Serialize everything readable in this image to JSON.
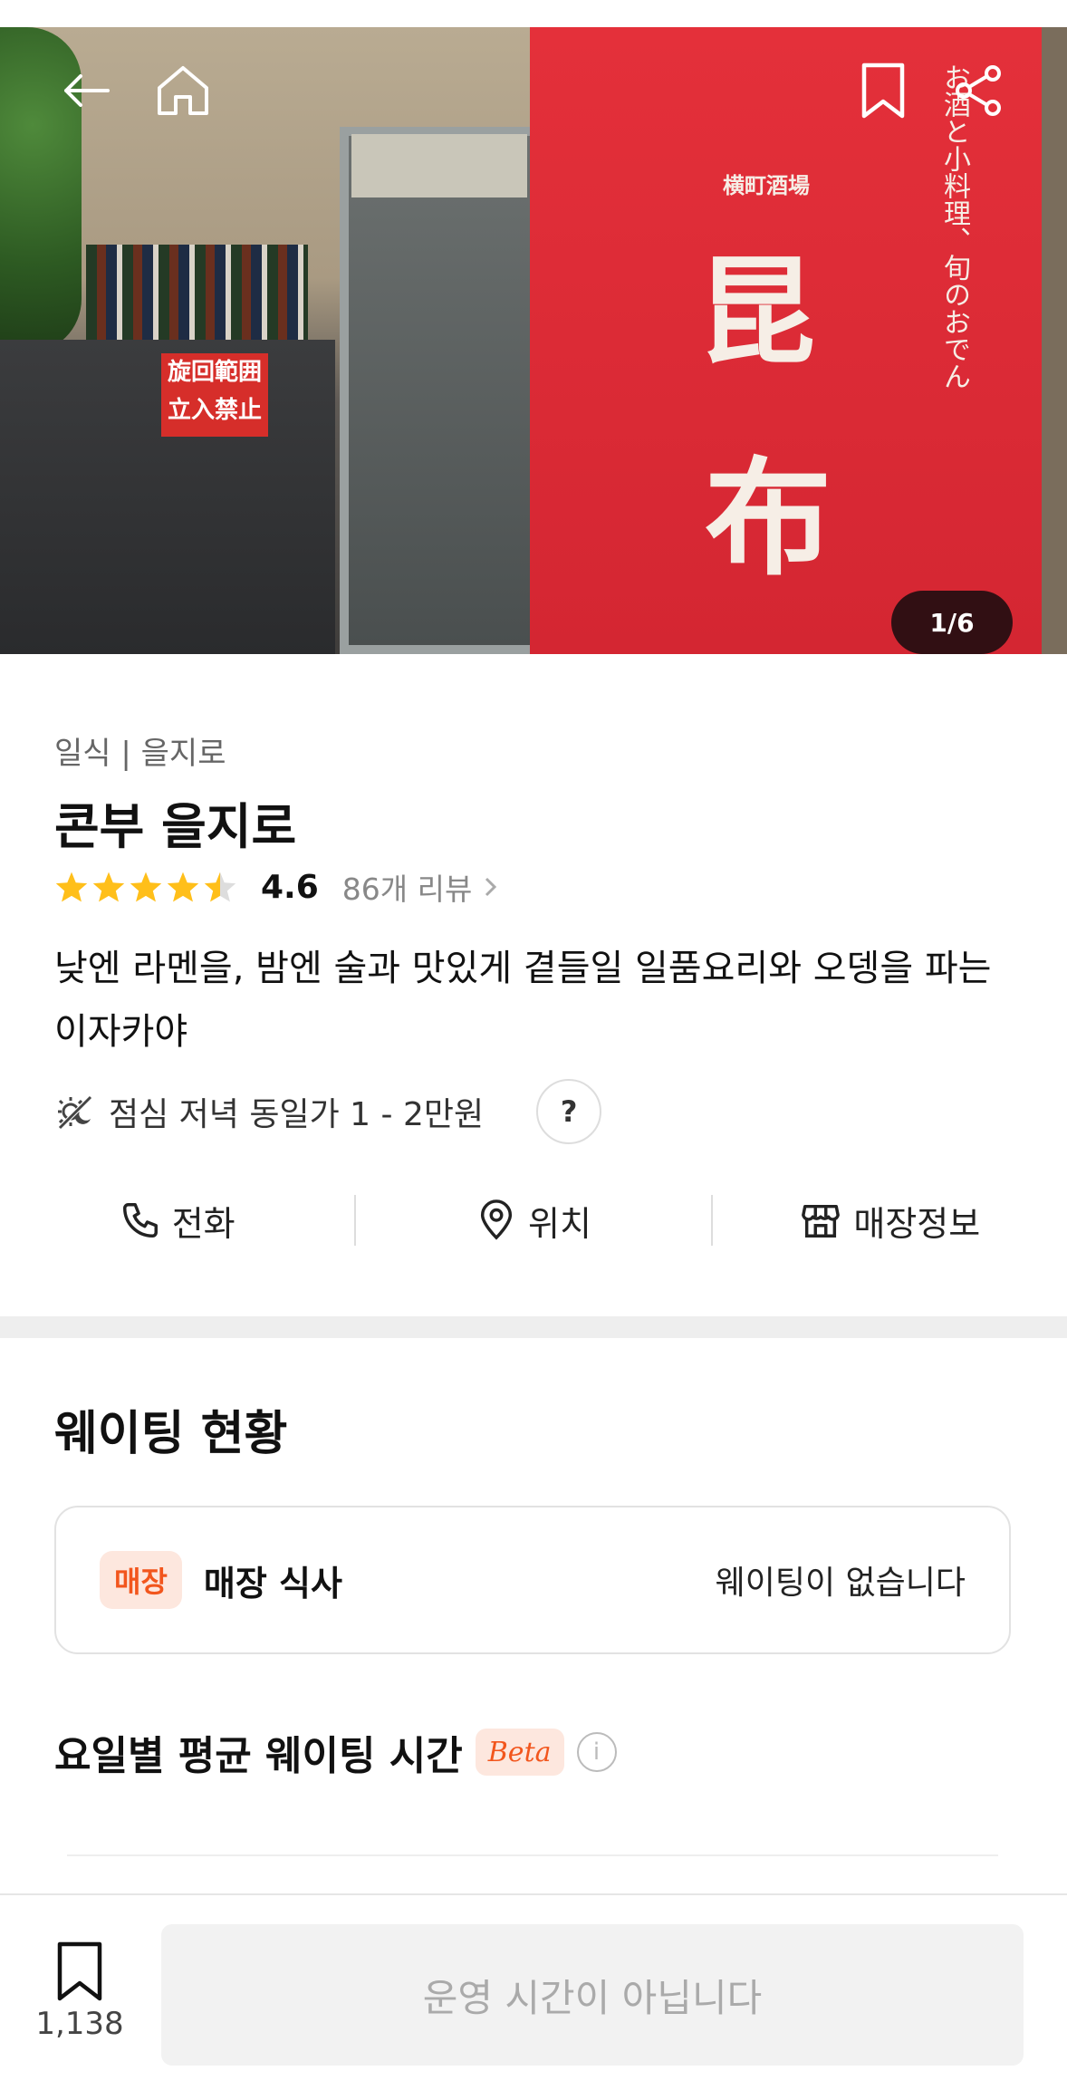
{
  "hero": {
    "counter": "1/6",
    "curtain_small_text": "横町酒場",
    "curtain_kanji_top": "昆",
    "curtain_kanji_bottom": "布",
    "curtain_vertical_text": "お酒と小料理、旬のおでん",
    "sign_text": "旋回範囲 立入禁止"
  },
  "topbar": {
    "icons": [
      "back-arrow-icon",
      "home-icon",
      "bookmark-icon",
      "share-icon"
    ]
  },
  "restaurant": {
    "category": "일식 | 을지로",
    "name": "콘부 을지로",
    "rating": "4.6",
    "stars_filled": 4.5,
    "review_link": "86개 리뷰",
    "description": "낮엔 라멘을, 밤엔 술과 맛있게 곁들일 일품요리와 오뎅을 파는 이자카야",
    "price": "점심 저녁 동일가 1 - 2만원",
    "help_label": "?"
  },
  "actions": {
    "call": "전화",
    "location": "위치",
    "store_info": "매장정보"
  },
  "waiting": {
    "title": "웨이팅 현황",
    "badge": "매장",
    "dine_in_label": "매장 식사",
    "status": "웨이팅이 없습니다",
    "avg_title": "요일별 평균 웨이팅 시간",
    "beta_label": "Beta",
    "info_label": "i"
  },
  "bottom": {
    "bookmark_count": "1,138",
    "cta_label": "운영 시간이 아닙니다"
  },
  "colors": {
    "accent": "#f2561d",
    "badge_bg": "#fde7de",
    "star": "#ffbf1a",
    "separator": "#eeeeee"
  }
}
